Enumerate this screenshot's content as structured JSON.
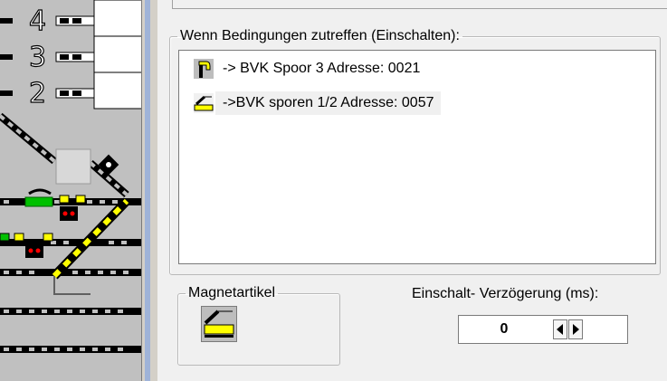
{
  "conditions": {
    "legend": "Wenn Bedingungen zutreffen (Einschalten):",
    "items": [
      {
        "label": "-> BVK Spoor 3 Adresse: 0021",
        "icon": "signal-icon"
      },
      {
        "label": "->BVK sporen 1/2 Adresse: 0057",
        "icon": "turnout-icon"
      }
    ]
  },
  "magnet": {
    "legend": "Magnetartikel",
    "icon": "turnout-icon"
  },
  "delay": {
    "label": "Einschalt- Verzögerung (ms):",
    "value": "0"
  },
  "trackplan": {
    "track_numbers": [
      "4",
      "3",
      "2"
    ]
  },
  "colors": {
    "accent_yellow": "#ffff00",
    "signal_green": "#00c000",
    "signal_red": "#ff0000",
    "track_dark": "#202020",
    "panel_bg": "#f0f0f0"
  }
}
